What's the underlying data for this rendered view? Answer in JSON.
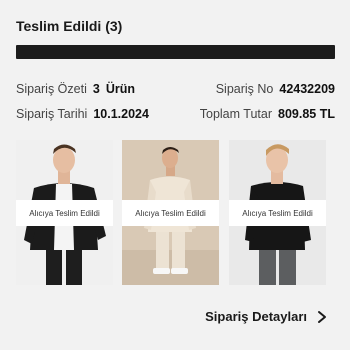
{
  "order": {
    "status_title": "Teslim Edildi (3)",
    "summary_label": "Sipariş Özeti",
    "summary_count": "3",
    "summary_unit": "Ürün",
    "order_no_label": "Sipariş No",
    "order_no": "42432209",
    "date_label": "Sipariş Tarihi",
    "date": "10.1.2024",
    "total_label": "Toplam Tutar",
    "total": "809.85 TL",
    "progress": 1.0
  },
  "products": [
    {
      "badge": "Alıcıya Teslim Edildi"
    },
    {
      "badge": "Alıcıya Teslim Edildi"
    },
    {
      "badge": "Alıcıya Teslim Edildi"
    }
  ],
  "footer": {
    "details_link": "Sipariş Detayları",
    "chevron_icon": "chevron-right-icon"
  },
  "colors": {
    "background": "#f2f2f2",
    "progress": "#1c1c1c",
    "text": "#1a1a1a"
  }
}
